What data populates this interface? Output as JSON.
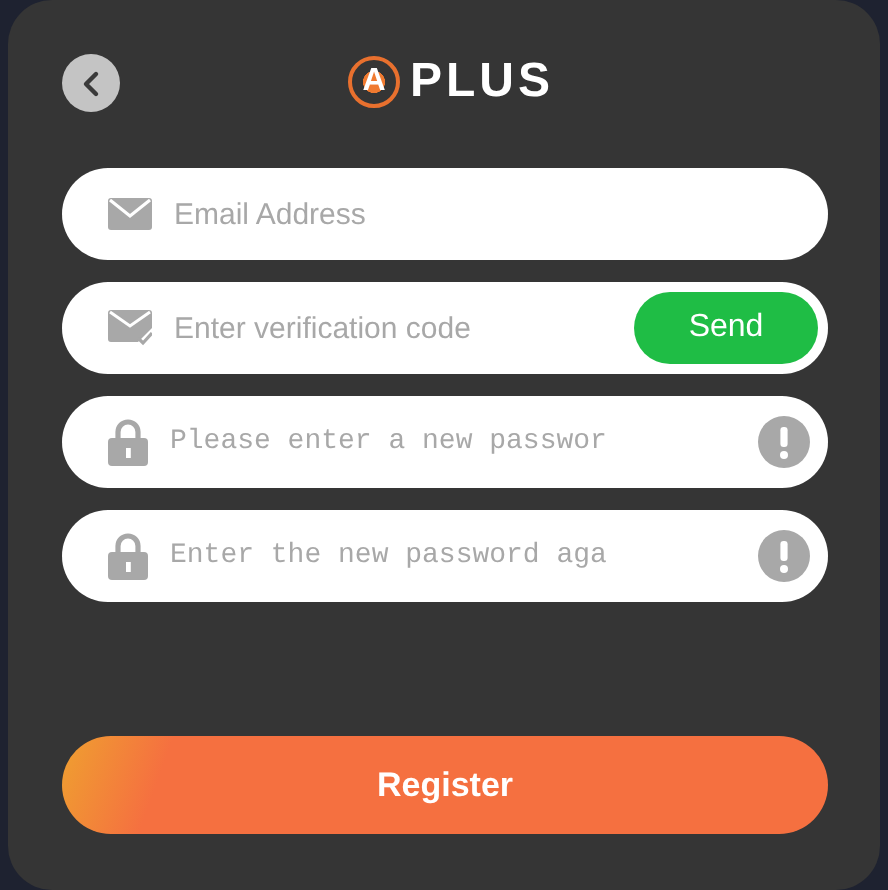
{
  "header": {
    "logo": {
      "mark": "A",
      "text": "PLUS"
    }
  },
  "fields": [
    {
      "kind": "email",
      "placeholder": "Email Address"
    },
    {
      "kind": "code",
      "placeholder": "Enter verification code",
      "button": "Send"
    },
    {
      "kind": "password",
      "placeholder": "Please enter a new passwor"
    },
    {
      "kind": "password",
      "placeholder": "Enter the new password aga"
    }
  ],
  "submit": "Register"
}
